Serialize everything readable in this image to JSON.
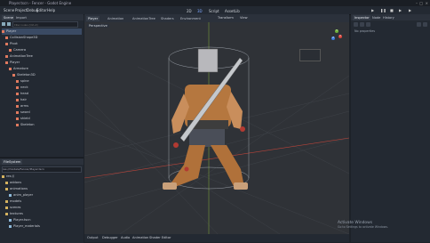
{
  "window": {
    "title": "Player.tscn - Fencer - Godot Engine"
  },
  "menu": {
    "items": [
      "Scene",
      "Project",
      "Debug",
      "Editor",
      "Help"
    ]
  },
  "workspaces": {
    "items": [
      "2D",
      "3D",
      "Script",
      "AssetLib"
    ]
  },
  "scene_dock": {
    "tabs": [
      "Scene",
      "Import"
    ],
    "filter_placeholder": "Filter nodes (Ctrl+F)",
    "nodes": [
      "Player",
      "CollisionShape3D",
      "Pivot",
      "Camera",
      "AnimationTree",
      "Player",
      "Armature",
      "Skeleton3D",
      "spine",
      "neck",
      "head",
      "hair",
      "arms",
      "sword",
      "shield",
      "Skeleton"
    ]
  },
  "filesystem_dock": {
    "title": "FileSystem",
    "path": "res://models/Fencer/Player.tscn",
    "items": [
      "res://",
      "addons",
      "animations",
      "anim_player",
      "models",
      "scenes",
      "textures",
      "Player.tscn",
      "Player_materials"
    ]
  },
  "viewport": {
    "tabs": [
      "Player",
      "Animation",
      "AnimationTree",
      "Shaders",
      "Environment"
    ],
    "toolbar": [
      "Transform",
      "View"
    ],
    "perspective_label": "Perspective",
    "gizmo_axes": [
      "X",
      "Y",
      "Z"
    ]
  },
  "bottom_panel": {
    "tabs": [
      "Output",
      "Debugger",
      "Audio",
      "Animation",
      "Shader Editor"
    ]
  },
  "inspector": {
    "tabs": [
      "Inspector",
      "Node",
      "History"
    ],
    "subheader": "No properties"
  },
  "watermark": {
    "line1": "Activate Windows",
    "line2": "Go to Settings to activate Windows."
  },
  "colors": {
    "accent": "#3a6fd8",
    "bg": "#1d2229",
    "panel": "#232932"
  }
}
